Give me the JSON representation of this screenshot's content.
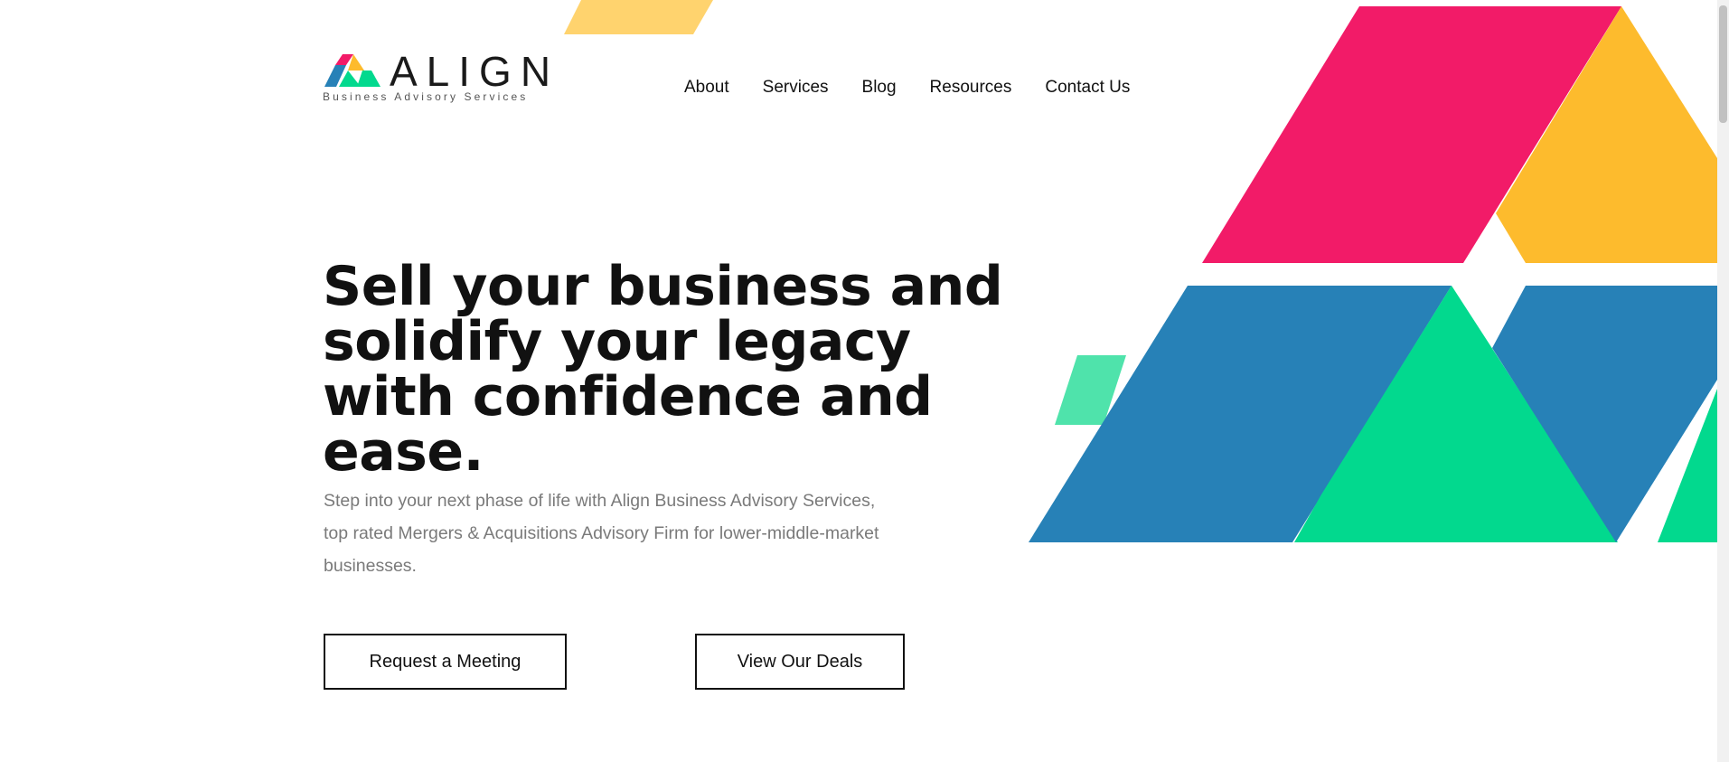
{
  "brand": {
    "name": "ALIGN",
    "tagline": "Business Advisory Services",
    "logo_icon": "triangles-logo-icon"
  },
  "nav": {
    "items": [
      {
        "label": "About"
      },
      {
        "label": "Services"
      },
      {
        "label": "Blog"
      },
      {
        "label": "Resources"
      },
      {
        "label": "Contact Us"
      }
    ]
  },
  "hero": {
    "headline": "Sell your business and solidify your legacy with confidence and ease.",
    "lede": "Step into your next phase of life with Align Business Advisory Services, top rated Mergers & Acquisitions Advisory Firm for lower-middle-market businesses.",
    "buttons": {
      "meeting": "Request a Meeting",
      "deals": "View Our Deals"
    }
  },
  "colors": {
    "pink": "#f21b68",
    "yellow": "#fdbb2d",
    "light_yellow": "#ffd36e",
    "blue": "#2781b7",
    "green": "#02d98e",
    "light_green": "#4fe3ab",
    "text": "#111111",
    "muted": "#7a7a7a"
  }
}
